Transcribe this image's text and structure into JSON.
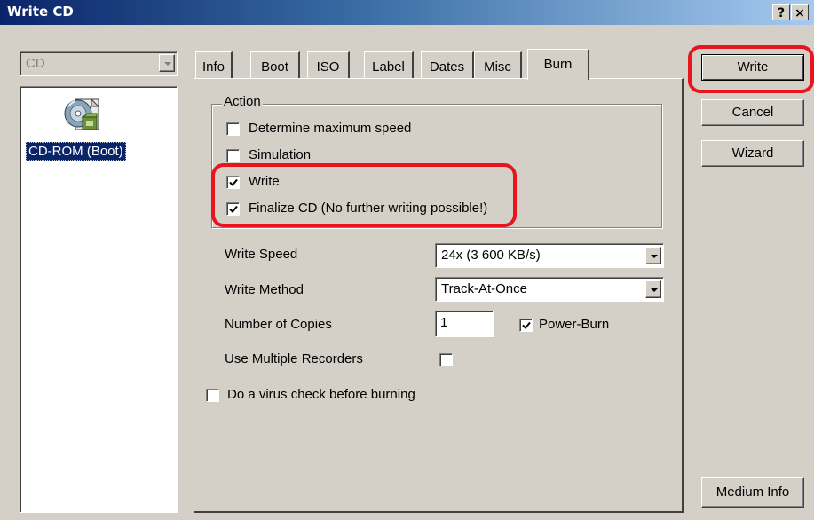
{
  "window": {
    "title": "Write CD",
    "help_glyph": "?",
    "close_glyph": "×"
  },
  "left": {
    "combo_value": "CD",
    "item_label": "CD-ROM (Boot)",
    "item_icon": "cd-rom-boot-icon"
  },
  "tabs": [
    {
      "label": "Info",
      "active": false
    },
    {
      "label": "Boot",
      "active": false
    },
    {
      "label": "ISO",
      "active": false
    },
    {
      "label": "Label",
      "active": false
    },
    {
      "label": "Dates",
      "active": false
    },
    {
      "label": "Misc",
      "active": false
    },
    {
      "label": "Burn",
      "active": true
    }
  ],
  "action_group": {
    "title": "Action",
    "options": [
      {
        "label": "Determine maximum speed",
        "checked": false
      },
      {
        "label": "Simulation",
        "checked": false
      },
      {
        "label": "Write",
        "checked": true
      },
      {
        "label": "Finalize CD (No further writing possible!)",
        "checked": true
      }
    ]
  },
  "settings": {
    "write_speed_label": "Write Speed",
    "write_speed_value": "24x (3 600 KB/s)",
    "write_method_label": "Write Method",
    "write_method_value": "Track-At-Once",
    "copies_label": "Number of Copies",
    "copies_value": "1",
    "power_burn_label": "Power-Burn",
    "power_burn_checked": true,
    "multi_recorders_label": "Use Multiple Recorders",
    "multi_recorders_checked": false,
    "virus_check_label": "Do a virus check before burning",
    "virus_check_checked": false
  },
  "buttons": {
    "write": "Write",
    "cancel": "Cancel",
    "wizard": "Wizard",
    "medium_info": "Medium Info"
  },
  "colors": {
    "highlight": "#e8141e",
    "title_bar": "#0a246a",
    "face": "#d4d0c8"
  }
}
